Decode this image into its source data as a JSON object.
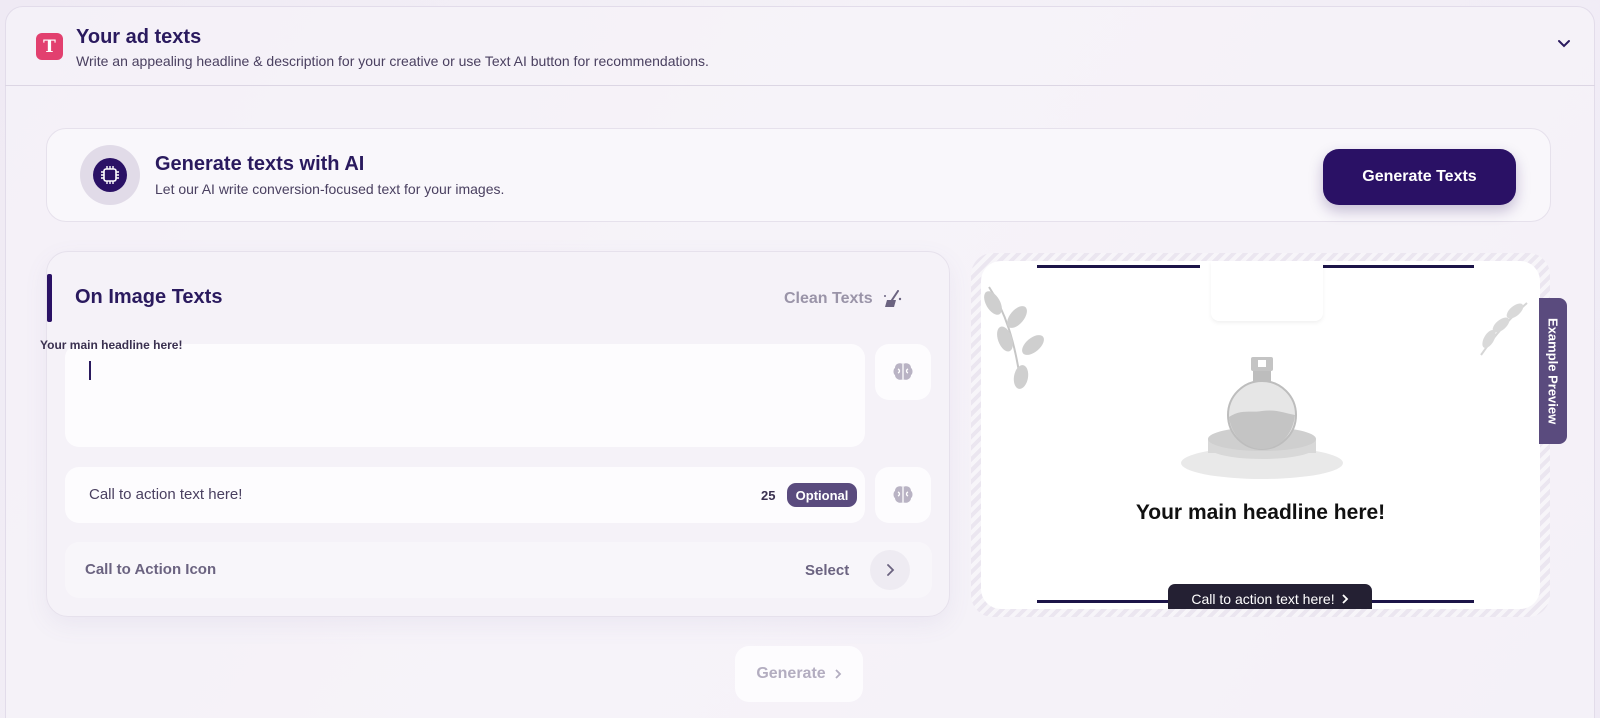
{
  "header": {
    "badge": "T",
    "title": "Your ad texts",
    "subtitle": "Write an appealing headline & description for your creative or use Text AI button for recommendations."
  },
  "ai_card": {
    "title": "Generate texts with AI",
    "subtitle": "Let our AI write conversion-focused text for your images.",
    "button_label": "Generate Texts"
  },
  "image_texts": {
    "title": "On Image Texts",
    "clean_label": "Clean Texts",
    "headline_label": "Your main headline here!",
    "headline_value": "",
    "cta_placeholder": "Call to action text here!",
    "cta_count": "25",
    "cta_badge": "Optional",
    "icon_label": "Call to Action Icon",
    "icon_select": "Select"
  },
  "preview": {
    "headline": "Your main headline here!",
    "cta": "Call to action text here!",
    "tab_label": "Example Preview"
  },
  "footer": {
    "generate_label": "Generate"
  },
  "colors": {
    "brand": "#2a1165",
    "badge": "#e2406f",
    "pill": "#5a4b7e"
  }
}
